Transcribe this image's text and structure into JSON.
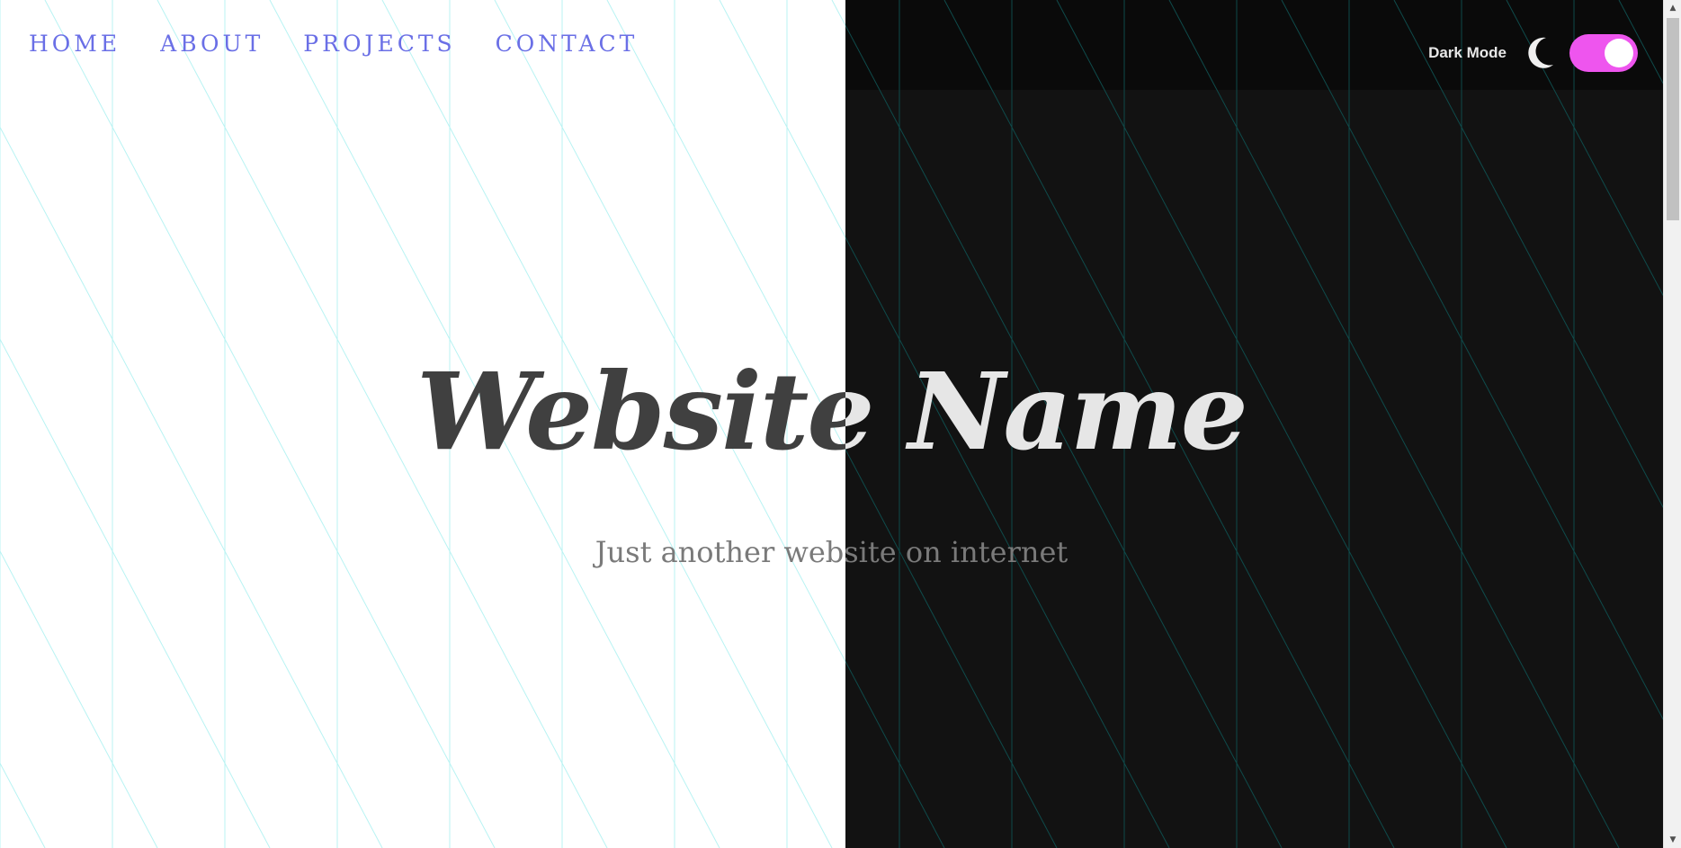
{
  "nav": {
    "items": [
      {
        "label": "HOME"
      },
      {
        "label": "ABOUT"
      },
      {
        "label": "PROJECTS"
      },
      {
        "label": "CONTACT"
      }
    ]
  },
  "dark_mode": {
    "label": "Dark Mode",
    "icon": "moon-icon",
    "enabled": true,
    "toggle_color": "#ee55ee"
  },
  "hero": {
    "title": "Website Name",
    "subtitle": "Just another website on internet"
  },
  "colors": {
    "nav_link": "#6a6fe6",
    "light_bg": "#ffffff",
    "dark_bg": "#121212",
    "grid_light": "#b8f3f3",
    "grid_dark": "#0f4b4b"
  },
  "scrollbar": {
    "up_glyph": "▲",
    "down_glyph": "▼"
  }
}
